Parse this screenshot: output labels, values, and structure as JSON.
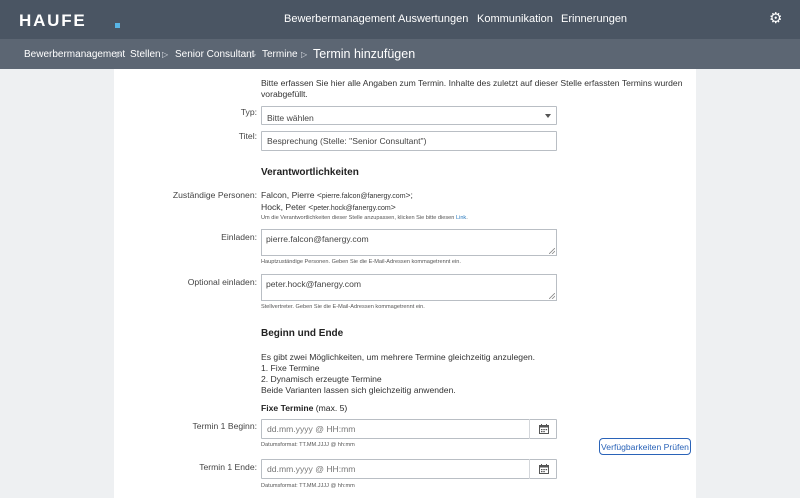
{
  "header": {
    "logo": "HAUFE",
    "nav": [
      "Bewerbermanagement",
      "Auswertungen",
      "Kommunikation",
      "Erinnerungen"
    ],
    "settings_icon": "gear-icon"
  },
  "breadcrumb": {
    "items": [
      "Bewerbermanagement",
      "Stellen",
      "Senior Consultant",
      "Termine"
    ],
    "current": "Termin hinzufügen",
    "separator_icon": "triangle-right-icon"
  },
  "form": {
    "intro_line1": "Bitte erfassen Sie hier alle Angaben zum Termin. Inhalte des zuletzt auf dieser Stelle erfassten Termins wurden",
    "intro_line2": "vorabgefüllt.",
    "typ_label": "Typ:",
    "typ_value": "Bitte wählen",
    "titel_label": "Titel:",
    "titel_value": "Besprechung (Stelle: \"Senior Consultant\")",
    "section_verantwortlich": "Verantwortlichkeiten",
    "zustaendig_label": "Zuständige Personen:",
    "person1_name": "Falcon, Pierre <",
    "person1_email": "pierre.falcon@fanergy.com",
    "person1_end": ">;",
    "person2_name": "Hock, Peter <",
    "person2_email": "peter.hock@fanergy.com",
    "person2_end": ">",
    "zustaendig_help": "Um die Verantwortlichkeiten dieser Stelle anzupassen, klicken Sie bitte diesen",
    "zustaendig_help_link": "Link",
    "zustaendig_help_end": ".",
    "einladen_label": "Einladen:",
    "einladen_value": "pierre.falcon@fanergy.com",
    "einladen_help": "Hauptzuständige Personen. Geben Sie die E-Mail-Adressen kommagetrennt ein.",
    "optional_label": "Optional einladen:",
    "optional_value": "peter.hock@fanergy.com",
    "optional_help": "Stellvertreter. Geben Sie die E-Mail-Adressen kommagetrennt ein.",
    "section_beginn": "Beginn und Ende",
    "info_line1": "Es gibt zwei Möglichkeiten, um mehrere Termine gleichzeitig anzulegen.",
    "info_line2": "1. Fixe Termine",
    "info_line3": "2. Dynamisch erzeugte Termine",
    "info_line4": "Beide Varianten lassen sich gleichzeitig anwenden.",
    "fixe_heading": "Fixe Termine",
    "fixe_max": "(max. 5)",
    "beginn_label": "Termin 1 Beginn:",
    "beginn_placeholder": "dd.mm.yyyy @ HH:mm",
    "beginn_help": "Datumsformat: TT.MM.JJJJ @ hh:mm",
    "ende_label": "Termin 1 Ende:",
    "ende_placeholder": "dd.mm.yyyy @ HH:mm",
    "ende_help": "Datumsformat: TT.MM.JJJJ @ hh:mm",
    "verfuegbarkeit_button": "Verfügbarkeiten Prüfen",
    "calendar_icon": "calendar-icon"
  }
}
